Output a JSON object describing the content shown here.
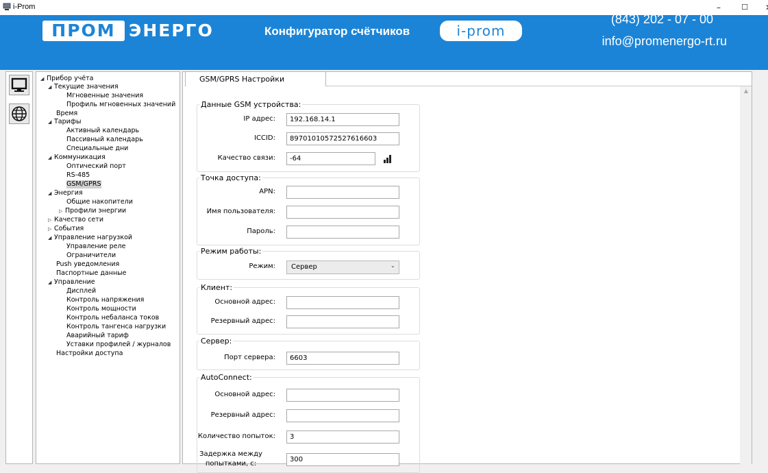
{
  "window": {
    "title": "i-Prom",
    "minimize": "–",
    "maximize": "☐",
    "close": "✕"
  },
  "header": {
    "logo_prom": "ПРОМ",
    "logo_energo": "ЭНЕРГО",
    "title": "Конфигуратор счётчиков",
    "badge": "i-prom",
    "phone": "(843) 202 - 07 - 00",
    "email": "info@promenergo-rt.ru",
    "color": "#1c84d6"
  },
  "iconbar": {
    "items": [
      {
        "icon": "computer-icon"
      },
      {
        "icon": "globe-icon"
      }
    ]
  },
  "tree": {
    "nodes": [
      {
        "label": "Прибор учёта",
        "arrow": "◢"
      },
      {
        "label": "Текущие значения",
        "arrow": "◢"
      },
      {
        "label": "Мгновенные значения",
        "arrow": ""
      },
      {
        "label": "Профиль мгновенных значений",
        "arrow": ""
      },
      {
        "label": "Время",
        "arrow": ""
      },
      {
        "label": "Тарифы",
        "arrow": "◢"
      },
      {
        "label": "Активный календарь",
        "arrow": ""
      },
      {
        "label": "Пассивный календарь",
        "arrow": ""
      },
      {
        "label": "Специальные дни",
        "arrow": ""
      },
      {
        "label": "Коммуникация",
        "arrow": "◢"
      },
      {
        "label": "Оптический порт",
        "arrow": ""
      },
      {
        "label": "RS-485",
        "arrow": ""
      },
      {
        "label": "GSM/GPRS",
        "arrow": ""
      },
      {
        "label": "Энергия",
        "arrow": "◢"
      },
      {
        "label": "Общие накопители",
        "arrow": ""
      },
      {
        "label": "Профили энергии",
        "arrow": "▷"
      },
      {
        "label": "Качество сети",
        "arrow": "▷"
      },
      {
        "label": "События",
        "arrow": "▷"
      },
      {
        "label": "Управление нагрузкой",
        "arrow": "◢"
      },
      {
        "label": "Управление реле",
        "arrow": ""
      },
      {
        "label": "Ограничители",
        "arrow": ""
      },
      {
        "label": "Push уведомления",
        "arrow": ""
      },
      {
        "label": "Паспортные данные",
        "arrow": ""
      },
      {
        "label": "Управление",
        "arrow": "◢"
      },
      {
        "label": "Дисплей",
        "arrow": ""
      },
      {
        "label": "Контроль напряжения",
        "arrow": ""
      },
      {
        "label": "Контроль мощности",
        "arrow": ""
      },
      {
        "label": "Контроль небаланса токов",
        "arrow": ""
      },
      {
        "label": "Контроль тангенса нагрузки",
        "arrow": ""
      },
      {
        "label": "Аварийный тариф",
        "arrow": ""
      },
      {
        "label": "Уставки профилей / журналов",
        "arrow": ""
      },
      {
        "label": "Настройки доступа",
        "arrow": ""
      }
    ],
    "selected": "GSM/GPRS"
  },
  "main": {
    "tab": "GSM/GPRS Настройки",
    "groups": {
      "gsm": {
        "title": "Данные GSM устройства:",
        "ip_label": "IP адрес:",
        "ip_value": "192.168.14.1",
        "iccid_label": "ICCID:",
        "iccid_value": "89701010572527616603",
        "quality_label": "Качество связи:",
        "quality_value": "-64",
        "quality_icon": "signal-strength-icon"
      },
      "apn": {
        "title": "Точка доступа:",
        "apn_label": "APN:",
        "apn_value": "",
        "user_label": "Имя пользователя:",
        "user_value": "",
        "pass_label": "Пароль:",
        "pass_value": ""
      },
      "mode": {
        "title": "Режим работы:",
        "mode_label": "Режим:",
        "mode_value": "Сервер"
      },
      "client": {
        "title": "Клиент:",
        "main_label": "Основной адрес:",
        "main_value": "",
        "backup_label": "Резервный адрес:",
        "backup_value": ""
      },
      "server": {
        "title": "Сервер:",
        "port_label": "Порт сервера:",
        "port_value": "6603"
      },
      "autoconnect": {
        "title": "AutoConnect:",
        "main_label": "Основной адрес:",
        "main_value": "",
        "backup_label": "Резервный адрес:",
        "backup_value": "",
        "attempts_label": "Количество попыток:",
        "attempts_value": "3",
        "delay_label": "Задержка между попытками, с:",
        "delay_value": "300"
      }
    }
  }
}
